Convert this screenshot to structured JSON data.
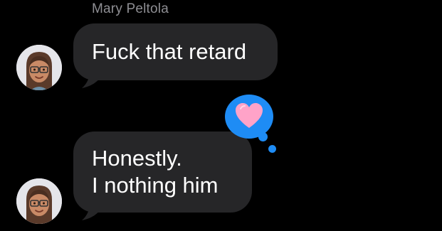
{
  "conversation": {
    "sender_name": "Mary Peltola",
    "messages": [
      {
        "lines": [
          "Fuck that retard"
        ],
        "avatar": "memoji-avatar"
      },
      {
        "lines": [
          "Honestly.",
          "I nothing him"
        ],
        "avatar": "memoji-avatar",
        "reaction": "heart-icon"
      }
    ]
  },
  "colors": {
    "background": "#000000",
    "incoming_bubble": "#262628",
    "message_text": "#ffffff",
    "sender_name_text": "#8e8e93",
    "tapback_bubble": "#1e8cf5",
    "heart": "#ffa3c8"
  }
}
